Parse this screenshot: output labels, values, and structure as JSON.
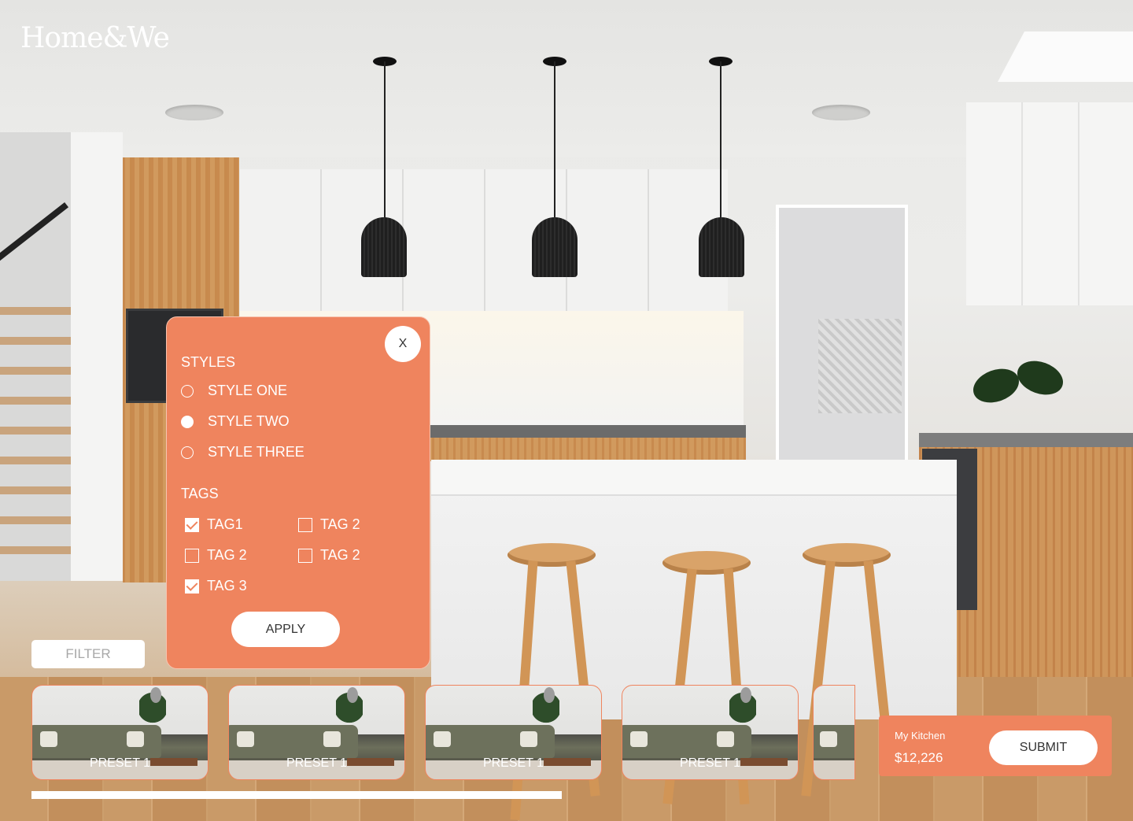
{
  "brand": {
    "logo_text": "Home&We"
  },
  "filter_panel": {
    "close_label": "X",
    "styles_title": "STYLES",
    "styles": [
      {
        "label": "STYLE ONE",
        "selected": false
      },
      {
        "label": "STYLE TWO",
        "selected": true
      },
      {
        "label": "STYLE THREE",
        "selected": false
      }
    ],
    "tags_title": "TAGS",
    "tags": [
      {
        "label": "TAG1",
        "checked": true
      },
      {
        "label": "TAG 2",
        "checked": false
      },
      {
        "label": "TAG 2",
        "checked": false
      },
      {
        "label": "TAG 2",
        "checked": false
      },
      {
        "label": "TAG 3",
        "checked": true
      }
    ],
    "apply_label": "APPLY"
  },
  "filter_button": {
    "label": "FILTER"
  },
  "presets": [
    {
      "label": "PRESET 1"
    },
    {
      "label": "PRESET 1"
    },
    {
      "label": "PRESET 1"
    },
    {
      "label": "PRESET 1"
    },
    {
      "label": ""
    }
  ],
  "summary": {
    "title": "My Kitchen",
    "price": "$12,226",
    "submit_label": "SUBMIT"
  },
  "colors": {
    "accent": "#ef845e",
    "white": "#ffffff",
    "muted_text": "#a8a8a8"
  }
}
